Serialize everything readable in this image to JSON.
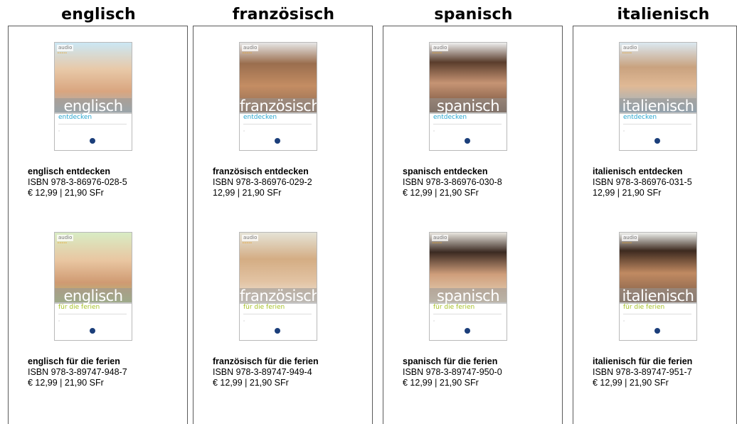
{
  "brand": {
    "name": "audio",
    "dots": "•••••"
  },
  "columns": [
    {
      "heading": "englisch",
      "books": [
        {
          "cover_lang": "englisch",
          "cover_sub": "entdecken",
          "title": "englisch entdecken",
          "isbn": "ISBN 978-3-86976-028-5",
          "price": "€ 12,99 | 21,90 SFr"
        },
        {
          "cover_lang": "englisch",
          "cover_sub": "für die ferien",
          "title": "englisch für die ferien",
          "isbn": "ISBN 978-3-89747-948-7",
          "price": "€ 12,99 | 21,90 SFr"
        }
      ]
    },
    {
      "heading": "französisch",
      "books": [
        {
          "cover_lang": "französisch",
          "cover_sub": "entdecken",
          "title": "französisch entdecken",
          "isbn": "ISBN 978-3-86976-029-2",
          "price": "12,99 | 21,90 SFr"
        },
        {
          "cover_lang": "französisch",
          "cover_sub": "für die ferien",
          "title": "französisch für die ferien",
          "isbn": "ISBN 978-3-89747-949-4",
          "price": "€ 12,99 | 21,90 SFr"
        }
      ]
    },
    {
      "heading": "spanisch",
      "books": [
        {
          "cover_lang": "spanisch",
          "cover_sub": "entdecken",
          "title": "spanisch entdecken",
          "isbn": "ISBN 978-3-86976-030-8",
          "price": "€ 12,99 | 21,90 SFr"
        },
        {
          "cover_lang": "spanisch",
          "cover_sub": "für die ferien",
          "title": "spanisch für die ferien",
          "isbn": "ISBN 978-3-89747-950-0",
          "price": "€ 12,99 | 21,90 SFr"
        }
      ]
    },
    {
      "heading": "italienisch",
      "books": [
        {
          "cover_lang": "italienisch",
          "cover_sub": "entdecken",
          "title": "italienisch entdecken",
          "isbn": "ISBN 978-3-86976-031-5",
          "price": "12,99 | 21,90 SFr"
        },
        {
          "cover_lang": "italienisch",
          "cover_sub": "für die ferien",
          "title": "italienisch für die ferien",
          "isbn": "ISBN 978-3-89747-951-7",
          "price": "€ 12,99 | 21,90 SFr"
        }
      ]
    }
  ],
  "colors": {
    "entdecken_accent": "#2aa6cf",
    "ferien_accent": "#a7c22a"
  }
}
